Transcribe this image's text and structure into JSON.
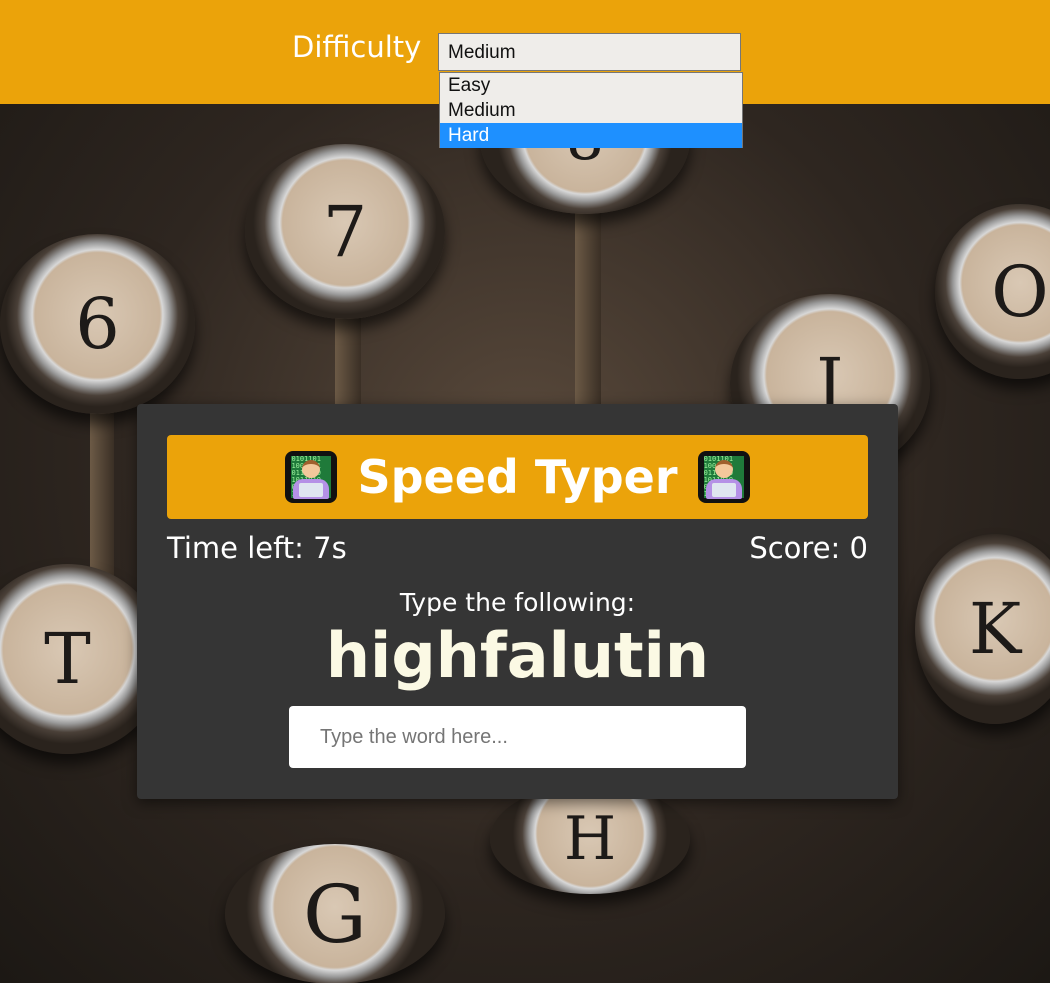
{
  "header": {
    "difficulty_label": "Difficulty",
    "difficulty_selected": "Medium",
    "difficulty_options": [
      "Easy",
      "Medium",
      "Hard"
    ],
    "highlighted_option": "Hard"
  },
  "game": {
    "title": "Speed Typer",
    "title_icon": "technologist-emoji",
    "time_label": "Time left: 7s",
    "score_label": "Score: 0",
    "prompt": "Type the following:",
    "word": "highfalutin",
    "input_placeholder": "Type the word here..."
  },
  "background": {
    "keys": [
      "6",
      "7",
      "8",
      "I",
      "O",
      "T",
      "K",
      "G",
      "H"
    ]
  },
  "colors": {
    "accent": "#eba30a",
    "card": "#353535",
    "selection": "#1e90ff",
    "word": "#fbf9e4"
  }
}
